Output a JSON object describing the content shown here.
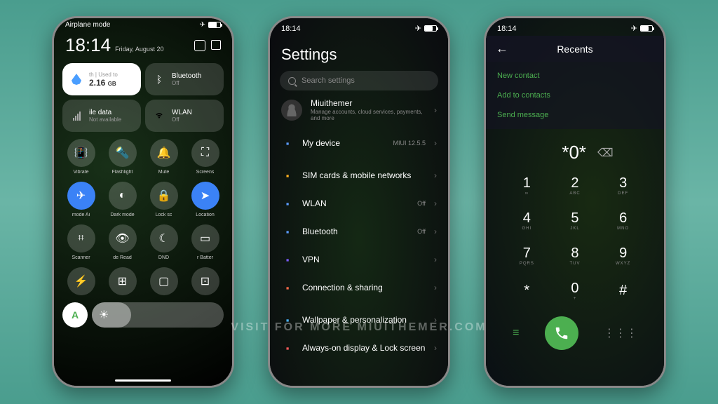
{
  "status": {
    "time": "18:14"
  },
  "phone1": {
    "airplane_label": "Airplane mode",
    "time": "18:14",
    "date": "Friday, August 20",
    "data_tile": {
      "used_label": "Used to",
      "value": "2.16",
      "unit": "GB",
      "sub": "th"
    },
    "bt_tile": {
      "label": "Bluetooth",
      "sub": "Off"
    },
    "mobile_tile": {
      "label": "ile data",
      "sub": "Not available"
    },
    "wlan_tile": {
      "label": "WLAN",
      "sub": "Off"
    },
    "toggles_r1": [
      {
        "label": "Vibrate",
        "icon": "vibrate"
      },
      {
        "label": "Flashlight",
        "icon": "flashlight"
      },
      {
        "label": "Mute",
        "icon": "mute"
      },
      {
        "label": "Screens",
        "icon": "screenshot"
      }
    ],
    "toggles_r2": [
      {
        "label": "mode   Ai",
        "icon": "airplane",
        "blue": true
      },
      {
        "label": "Dark mode",
        "icon": "darkmode"
      },
      {
        "label": "Lock sc",
        "icon": "lock"
      },
      {
        "label": "Location",
        "icon": "location",
        "blue": true
      }
    ],
    "toggles_r3": [
      {
        "label": "Scanner",
        "icon": "scanner"
      },
      {
        "label": "de   Read",
        "icon": "read"
      },
      {
        "label": "DND",
        "icon": "dnd"
      },
      {
        "label": "r    Batter",
        "icon": "battery"
      }
    ],
    "toggles_r4": [
      {
        "icon": "bolt"
      },
      {
        "icon": "apps"
      },
      {
        "icon": "cast"
      },
      {
        "icon": "record"
      }
    ],
    "accent_letter": "A"
  },
  "phone2": {
    "title": "Settings",
    "search_placeholder": "Search settings",
    "account": {
      "name": "Miuithemer",
      "sub": "Manage accounts, cloud services, payments, and more"
    },
    "items": [
      {
        "label": "My device",
        "right": "MIUI 12.5.5",
        "color": "#5b9bff"
      },
      {
        "label": "SIM cards & mobile networks",
        "color": "#ffb020"
      },
      {
        "label": "WLAN",
        "right": "Off",
        "color": "#5b9bff"
      },
      {
        "label": "Bluetooth",
        "right": "Off",
        "color": "#5b9bff"
      },
      {
        "label": "VPN",
        "color": "#7c5bff"
      },
      {
        "label": "Connection & sharing",
        "color": "#ff6b4a"
      },
      {
        "label": "Wallpaper & personalization",
        "color": "#4ab5ff"
      },
      {
        "label": "Always-on display & Lock screen",
        "color": "#ff5b5b"
      }
    ]
  },
  "phone3": {
    "title": "Recents",
    "actions": [
      "New contact",
      "Add to contacts",
      "Send message"
    ],
    "dialed": "*0*",
    "keys": [
      {
        "n": "1",
        "l": "∞"
      },
      {
        "n": "2",
        "l": "ABC"
      },
      {
        "n": "3",
        "l": "DEF"
      },
      {
        "n": "4",
        "l": "GHI"
      },
      {
        "n": "5",
        "l": "JKL"
      },
      {
        "n": "6",
        "l": "MNO"
      },
      {
        "n": "7",
        "l": "PQRS"
      },
      {
        "n": "8",
        "l": "TUV"
      },
      {
        "n": "9",
        "l": "WXYZ"
      },
      {
        "n": "*",
        "l": ""
      },
      {
        "n": "0",
        "l": "+"
      },
      {
        "n": "#",
        "l": ""
      }
    ]
  },
  "watermark": "VISIT FOR MORE   MIUITHEMER.COM"
}
